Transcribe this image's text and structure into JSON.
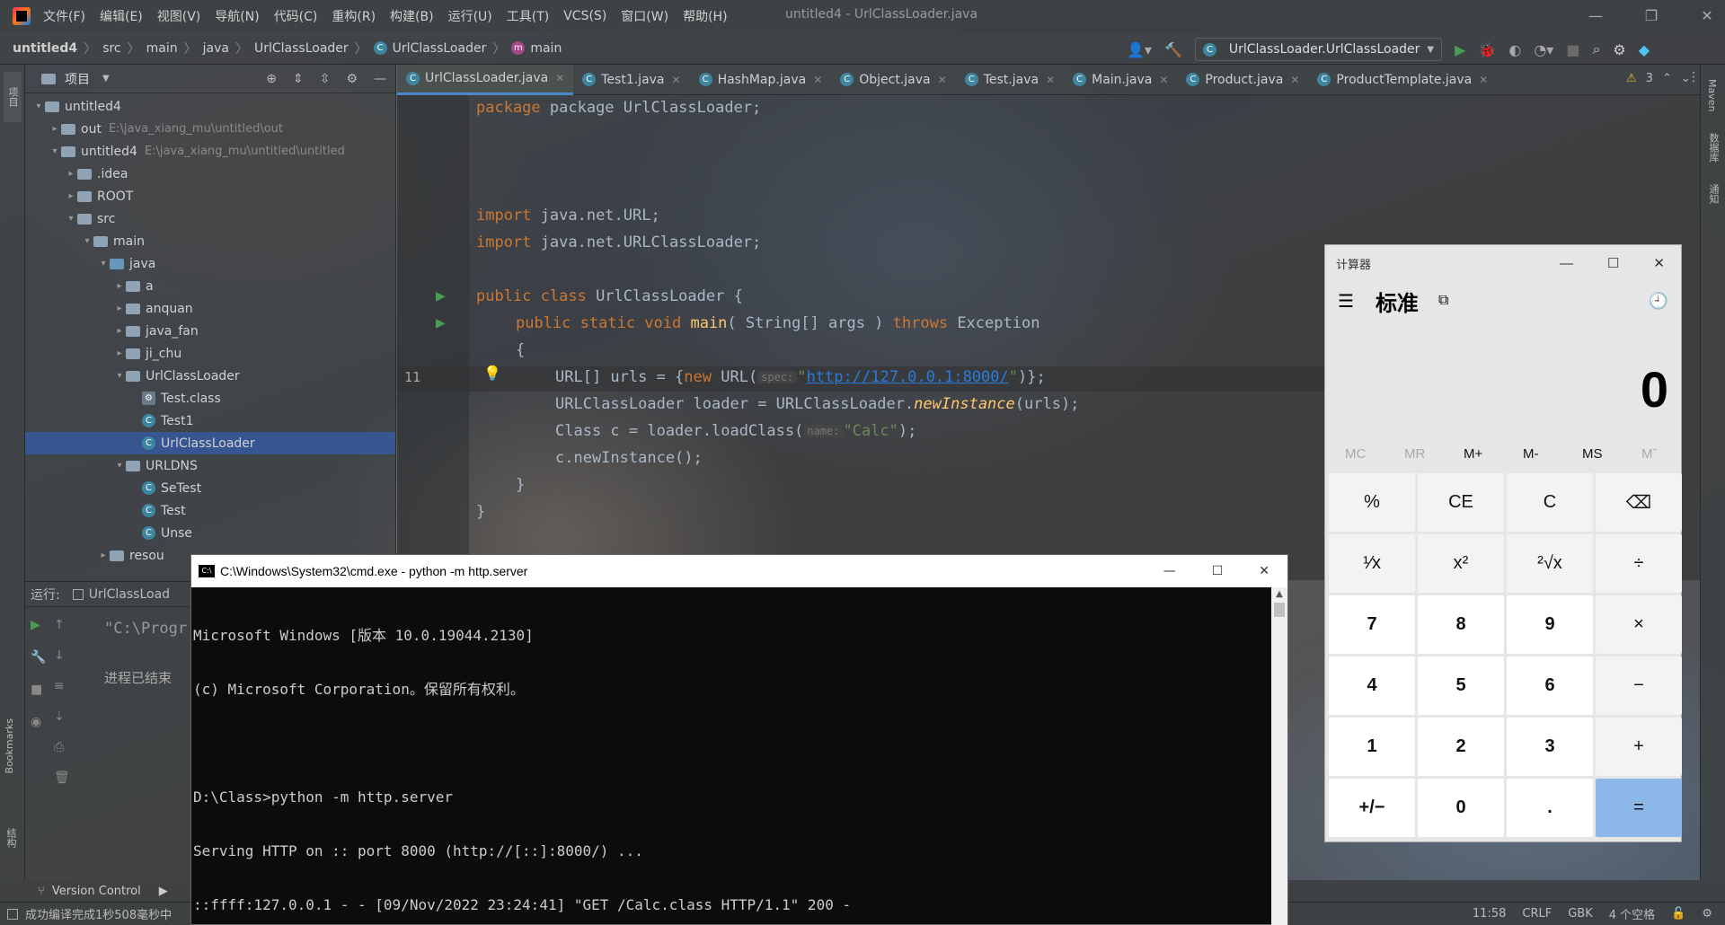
{
  "menu": [
    "文件(F)",
    "编辑(E)",
    "视图(V)",
    "导航(N)",
    "代码(C)",
    "重构(R)",
    "构建(B)",
    "运行(U)",
    "工具(T)",
    "VCS(S)",
    "窗口(W)",
    "帮助(H)"
  ],
  "window_title": "untitled4 - UrlClassLoader.java",
  "breadcrumb": [
    "untitled4",
    "src",
    "main",
    "java",
    "UrlClassLoader",
    "UrlClassLoader",
    "main"
  ],
  "run_config": "UrlClassLoader.UrlClassLoader",
  "project_label": "项目",
  "tree": [
    {
      "indent": 0,
      "arrow": "▾",
      "type": "module",
      "label": "untitled4",
      "note": ""
    },
    {
      "indent": 1,
      "arrow": "▸",
      "type": "folder",
      "label": "out",
      "note": "E:\\java_xiang_mu\\untitled\\out"
    },
    {
      "indent": 1,
      "arrow": "▾",
      "type": "module",
      "label": "untitled4",
      "note": "E:\\java_xiang_mu\\untitled\\untitled"
    },
    {
      "indent": 2,
      "arrow": "▸",
      "type": "folder",
      "label": ".idea",
      "note": ""
    },
    {
      "indent": 2,
      "arrow": "▸",
      "type": "folder",
      "label": "ROOT",
      "note": ""
    },
    {
      "indent": 2,
      "arrow": "▾",
      "type": "folder",
      "label": "src",
      "note": ""
    },
    {
      "indent": 3,
      "arrow": "▾",
      "type": "folder",
      "label": "main",
      "note": ""
    },
    {
      "indent": 4,
      "arrow": "▾",
      "type": "bfolder",
      "label": "java",
      "note": ""
    },
    {
      "indent": 5,
      "arrow": "▸",
      "type": "folder",
      "label": "a",
      "note": ""
    },
    {
      "indent": 5,
      "arrow": "▸",
      "type": "folder",
      "label": "anquan",
      "note": ""
    },
    {
      "indent": 5,
      "arrow": "▸",
      "type": "folder",
      "label": "java_fan",
      "note": ""
    },
    {
      "indent": 5,
      "arrow": "▸",
      "type": "folder",
      "label": "ji_chu",
      "note": ""
    },
    {
      "indent": 5,
      "arrow": "▾",
      "type": "folder",
      "label": "UrlClassLoader",
      "note": ""
    },
    {
      "indent": 6,
      "arrow": "",
      "type": "classfile",
      "label": "Test.class",
      "note": ""
    },
    {
      "indent": 6,
      "arrow": "",
      "type": "class",
      "label": "Test1",
      "note": ""
    },
    {
      "indent": 6,
      "arrow": "",
      "type": "class",
      "label": "UrlClassLoader",
      "note": "",
      "selected": true
    },
    {
      "indent": 5,
      "arrow": "▾",
      "type": "folder",
      "label": "URLDNS",
      "note": ""
    },
    {
      "indent": 6,
      "arrow": "",
      "type": "class",
      "label": "SeTest",
      "note": ""
    },
    {
      "indent": 6,
      "arrow": "",
      "type": "class",
      "label": "Test",
      "note": ""
    },
    {
      "indent": 6,
      "arrow": "",
      "type": "class",
      "label": "Unse",
      "note": ""
    },
    {
      "indent": 4,
      "arrow": "▸",
      "type": "folder",
      "label": "resou",
      "note": ""
    }
  ],
  "tabs": [
    "UrlClassLoader.java",
    "Test1.java",
    "HashMap.java",
    "Object.java",
    "Test.java",
    "Main.java",
    "Product.java",
    "ProductTemplate.java"
  ],
  "warnings": "3",
  "code": {
    "line1": "package UrlClassLoader;",
    "import1": "java.net.URL;",
    "import2": "java.net.URLClassLoader;",
    "class_decl": "UrlClassLoader {",
    "main_args": "( String[] args ) ",
    "exception": "Exception",
    "line11_num": "11",
    "urls_decl": "URL[] urls = {",
    "url_ctor": "URL(",
    "hint_spec": "spec:",
    "url": "http://127.0.0.1:8000/",
    "loader_decl": "URLClassLoader loader = URLClassLoader.",
    "new_instance": "newInstance",
    "loader_args": "(urls);",
    "class_load": "Class c = loader.loadClass(",
    "hint_name": "name:",
    "calc_str": "\"Calc\"",
    "new_inst_call": "c.newInstance();"
  },
  "run": {
    "label": "运行:",
    "tab": "UrlClassLoad",
    "line1": "\"C:\\Progr",
    "line2": "进程已结束"
  },
  "bottom": {
    "vc": "Version Control",
    "status": "成功编译完成1秒508毫秒中",
    "pos": "11:58",
    "crlf": "CRLF",
    "enc": "GBK",
    "indent": "4 个空格"
  },
  "side": {
    "bookmarks": "Bookmarks",
    "structure": "结构",
    "maven": "Maven",
    "db": "数据库",
    "notif": "通知"
  },
  "cmd": {
    "title": "C:\\Windows\\System32\\cmd.exe - python  -m http.server",
    "lines": [
      "Microsoft Windows [版本 10.0.19044.2130]",
      "(c) Microsoft Corporation。保留所有权利。",
      "",
      "D:\\Class>python -m http.server",
      "Serving HTTP on :: port 8000 (http://[::]:8000/) ...",
      "::ffff:127.0.0.1 - - [09/Nov/2022 23:24:41] \"GET /Calc.class HTTP/1.1\" 200 -"
    ]
  },
  "calc": {
    "title": "计算器",
    "mode": "标准",
    "display": "0",
    "memory": [
      "MC",
      "MR",
      "M+",
      "M-",
      "MS",
      "Mˇ"
    ],
    "buttons": [
      "%",
      "CE",
      "C",
      "⌫",
      "¹⁄x",
      "x²",
      "²√x",
      "÷",
      "7",
      "8",
      "9",
      "×",
      "4",
      "5",
      "6",
      "−",
      "1",
      "2",
      "3",
      "+",
      "+/−",
      "0",
      ".",
      "="
    ]
  },
  "colors": {
    "accent": "#4a88c7",
    "calc_equals": "#8bb8e8"
  }
}
